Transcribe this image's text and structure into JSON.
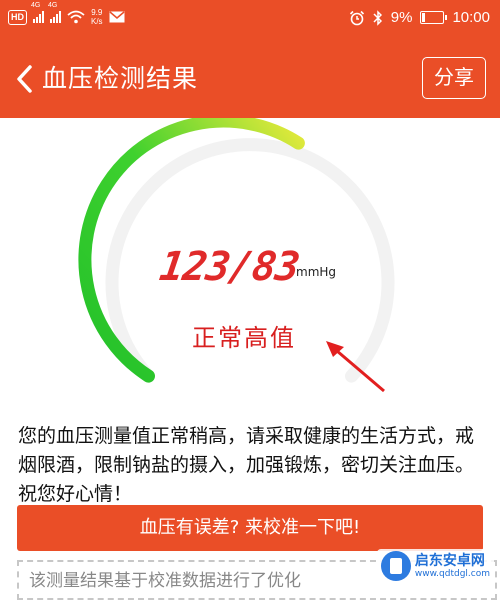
{
  "status_bar": {
    "hd": "HD",
    "signal1": "4G",
    "signal2": "4G",
    "speed_value": "9.9",
    "speed_unit": "K/s",
    "battery": "9%",
    "time": "10:00"
  },
  "header": {
    "title": "血压检测结果",
    "share_label": "分享"
  },
  "result": {
    "reading": "123/83",
    "unit": "mmHg",
    "level": "正常高值",
    "gauge_fraction": 0.55,
    "colors": {
      "gauge_start": "#22c02a",
      "gauge_end": "#e9ea3c",
      "track": "#f2f2f2",
      "value": "#e02a2a"
    }
  },
  "advice": "您的血压测量值正常稍高，请采取健康的生活方式，戒烟限酒，限制钠盐的摄入，加强锻炼，密切关注血压。祝您好心情！",
  "calibrate_button": "血压有误差? 来校准一下吧!",
  "note": "该测量结果基于校准数据进行了优化",
  "watermark": {
    "name": "启东安卓网",
    "url": "www.qdtdgl.com"
  },
  "theme": {
    "primary": "#ea4e27"
  }
}
